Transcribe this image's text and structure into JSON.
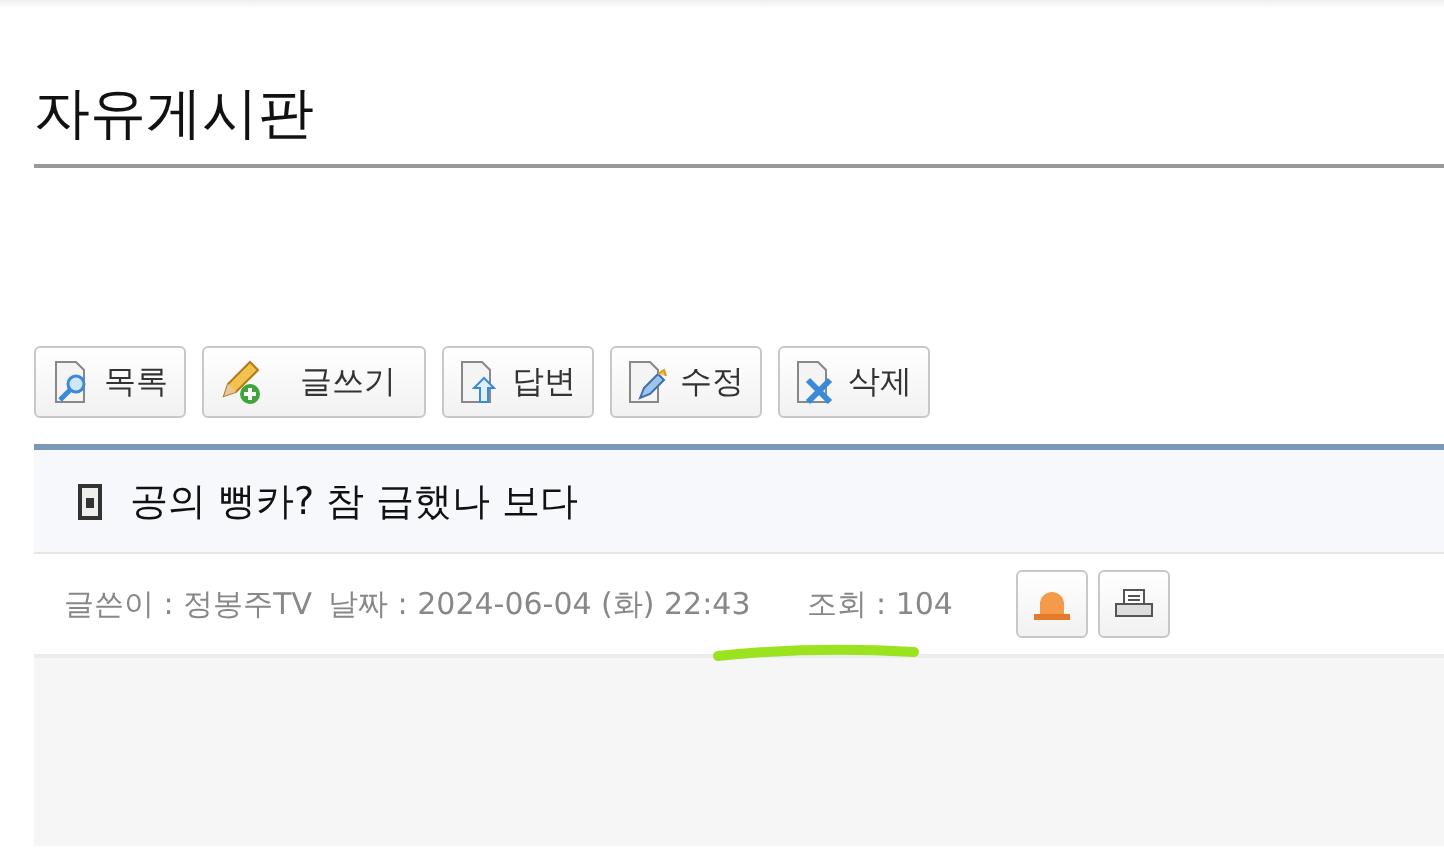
{
  "board_title": "자유게시판",
  "toolbar": [
    {
      "kind": "list",
      "label": "목록"
    },
    {
      "kind": "write",
      "label": "글쓰기"
    },
    {
      "kind": "reply",
      "label": "답변"
    },
    {
      "kind": "edit",
      "label": "수정"
    },
    {
      "kind": "delete",
      "label": "삭제"
    }
  ],
  "post": {
    "title": "공의 뻥카? 참 급했나 보다",
    "meta": [
      {
        "label": "글쓴이 :",
        "value": "정봉주TV"
      },
      {
        "label": "날짜 :",
        "value": "2024-06-04 (화) 22:43"
      },
      {
        "label": "조회 :",
        "value": "104"
      }
    ],
    "actions": [
      {
        "kind": "report"
      },
      {
        "kind": "print"
      }
    ]
  }
}
